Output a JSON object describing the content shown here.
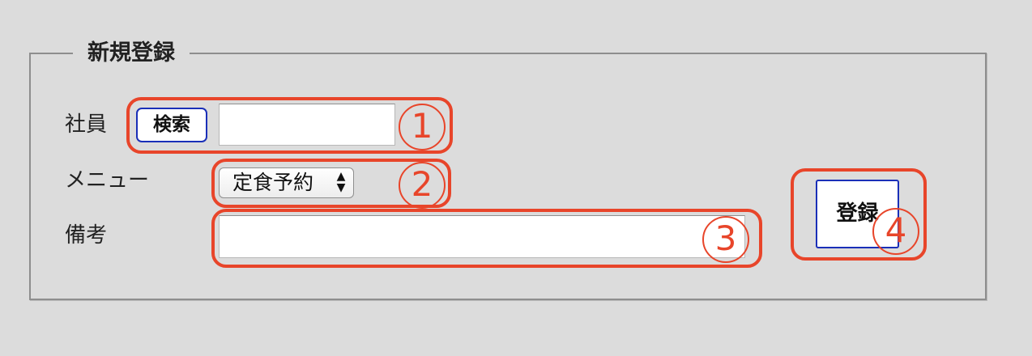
{
  "form": {
    "legend": "新規登録",
    "employee_label": "社員",
    "search_button": "検索",
    "employee_value": "",
    "menu_label": "メニュー",
    "menu_selected": "定食予約",
    "remarks_label": "備考",
    "remarks_value": "",
    "register_button": "登録"
  },
  "annotations": {
    "n1": "1",
    "n2": "2",
    "n3": "3",
    "n4": "4"
  },
  "colors": {
    "annotation": "#e8452a",
    "button_border": "#1a2fb8",
    "background": "#dcdcdc"
  },
  "icons": {
    "select_arrows": "up-down-arrows-icon"
  }
}
